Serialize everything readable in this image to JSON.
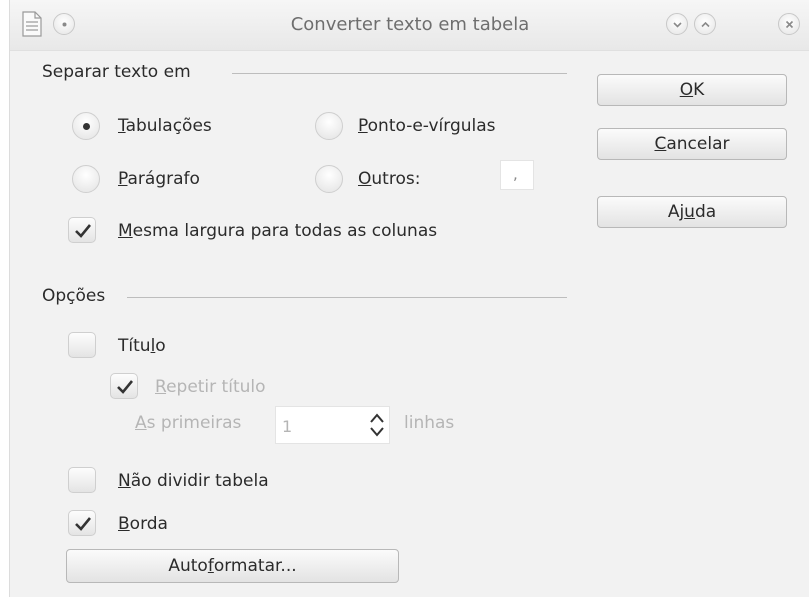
{
  "window": {
    "title": "Converter texto em tabela"
  },
  "separate": {
    "heading": "Separar texto em",
    "tabs": {
      "label": "Tabulações",
      "selected": true
    },
    "semicolons": {
      "label": "Ponto-e-vírgulas",
      "selected": false
    },
    "paragraph": {
      "label": "Parágrafo",
      "selected": false
    },
    "other": {
      "label": "Outros:",
      "selected": false,
      "value": ","
    },
    "equal_width": {
      "label": "Mesma largura para todas as colunas",
      "checked": true
    }
  },
  "options": {
    "heading": "Opções",
    "title": {
      "label": "Título",
      "checked": false
    },
    "repeat_title": {
      "label": "Repetir título",
      "checked": true,
      "enabled": false
    },
    "first_rows": {
      "prefix": "As primeiras",
      "value": "1",
      "suffix": "linhas",
      "enabled": false
    },
    "dont_split": {
      "label": "Não dividir tabela",
      "checked": false
    },
    "border": {
      "label": "Borda",
      "checked": true
    },
    "autoformat_label": "Autoformatar..."
  },
  "buttons": {
    "ok": "OK",
    "cancel": "Cancelar",
    "help": "Ajuda"
  },
  "icons": [
    "document-icon",
    "menu-dot-icon",
    "minimize-icon",
    "maximize-icon",
    "close-icon"
  ]
}
